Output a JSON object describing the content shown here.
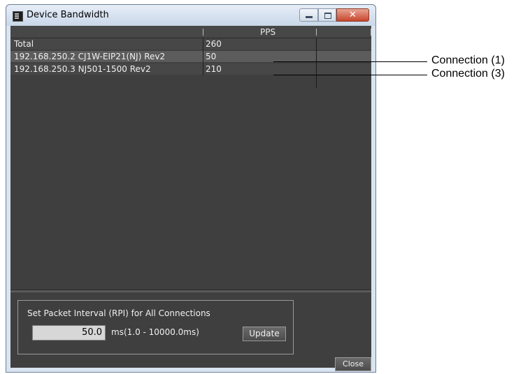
{
  "window": {
    "title": "Device Bandwidth",
    "close_glyph": "✕"
  },
  "table": {
    "columns": [
      "",
      "PPS"
    ],
    "rows": [
      {
        "name": "Total",
        "pps": "260"
      },
      {
        "name": "192.168.250.2 CJ1W-EIP21(NJ) Rev2",
        "pps": "50"
      },
      {
        "name": "192.168.250.3 NJ501-1500 Rev2",
        "pps": "210"
      }
    ]
  },
  "rpi": {
    "group_label": "Set Packet Interval (RPI) for All Connections",
    "value": "50.0",
    "range_label": "ms(1.0 - 10000.0ms)",
    "update_label": "Update"
  },
  "footer": {
    "close_label": "Close"
  },
  "callouts": [
    {
      "label": "Connection (1)"
    },
    {
      "label": "Connection (3)"
    }
  ]
}
